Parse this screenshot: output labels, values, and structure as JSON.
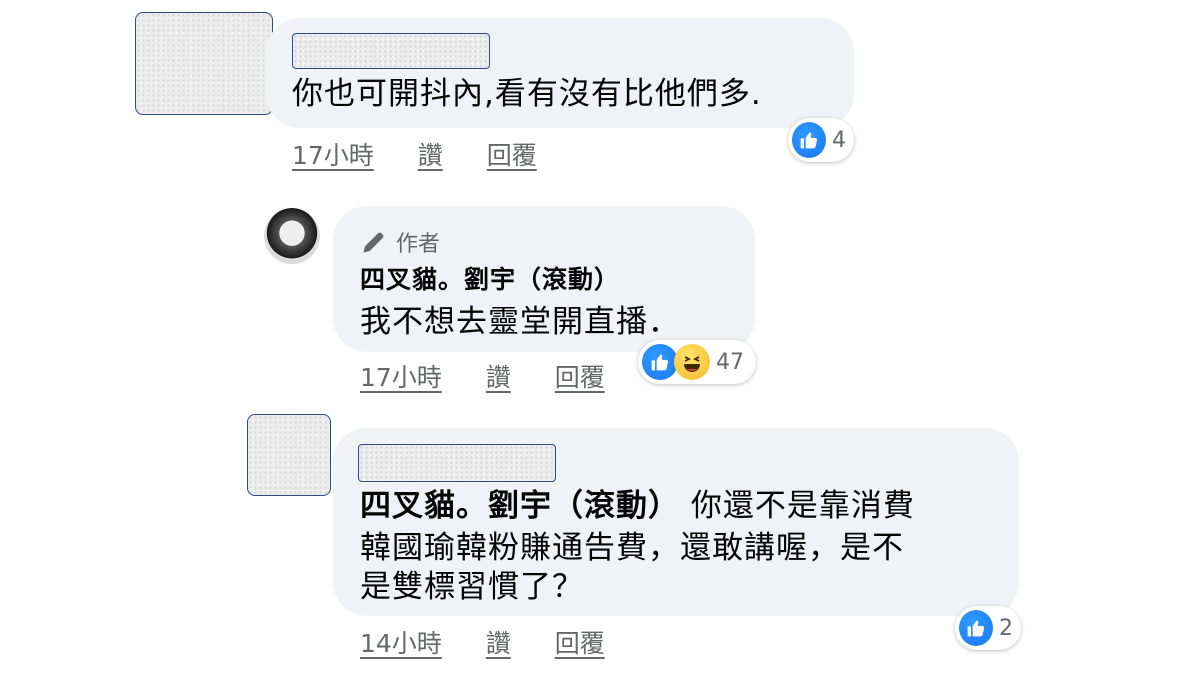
{
  "comments": [
    {
      "text": "你也可開抖內,看有沒有比他們多.",
      "time": "17小時",
      "like_label": "讚",
      "reply_label": "回覆",
      "reaction_count": "4"
    },
    {
      "badge": "作者",
      "author": "四叉貓。劉宇（滾動）",
      "text": "我不想去靈堂開直播．",
      "time": "17小時",
      "like_label": "讚",
      "reply_label": "回覆",
      "reaction_count": "47"
    },
    {
      "mention": "四叉貓。劉宇（滾動）",
      "text_line1": " 你還不是靠消費",
      "text_line2": "韓國瑜韓粉賺通告費，還敢講喔，是不",
      "text_line3": "是雙標習慣了？",
      "time": "14小時",
      "like_label": "讚",
      "reply_label": "回覆",
      "reaction_count": "2"
    }
  ],
  "colors": {
    "like": "#1877f2",
    "haha": "#f7b928",
    "bubble": "#f0f2f5",
    "meta": "#65676b"
  }
}
